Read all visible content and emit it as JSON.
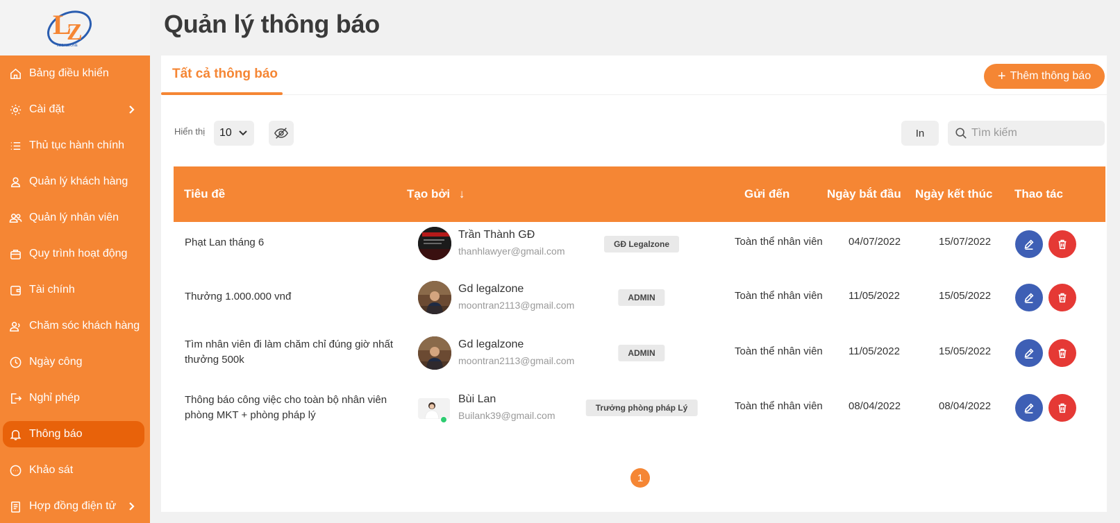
{
  "app": {
    "logo_name": "legalzone-logo"
  },
  "header": {
    "title": "Quản lý thông báo"
  },
  "sidebar": {
    "items": [
      {
        "label": "Bảng điều khiển",
        "icon": "home-icon",
        "has_submenu": false,
        "active": false
      },
      {
        "label": "Cài đặt",
        "icon": "gear-icon",
        "has_submenu": true,
        "active": false
      },
      {
        "label": "Thủ tục hành chính",
        "icon": "list-icon",
        "has_submenu": false,
        "active": false
      },
      {
        "label": "Quản lý khách hàng",
        "icon": "user-icon",
        "has_submenu": false,
        "active": false
      },
      {
        "label": "Quản lý nhân viên",
        "icon": "users-icon",
        "has_submenu": false,
        "active": false
      },
      {
        "label": "Quy trình hoạt động",
        "icon": "box-icon",
        "has_submenu": false,
        "active": false
      },
      {
        "label": "Tài chính",
        "icon": "wallet-icon",
        "has_submenu": false,
        "active": false
      },
      {
        "label": "Chăm sóc khách hàng",
        "icon": "user-care-icon",
        "has_submenu": false,
        "active": false
      },
      {
        "label": "Ngày công",
        "icon": "clock-icon",
        "has_submenu": false,
        "active": false
      },
      {
        "label": "Nghỉ phép",
        "icon": "logout-icon",
        "has_submenu": false,
        "active": false
      },
      {
        "label": "Thông báo",
        "icon": "bell-icon",
        "has_submenu": false,
        "active": true
      },
      {
        "label": "Khảo sát",
        "icon": "chat-icon",
        "has_submenu": false,
        "active": false
      },
      {
        "label": "Hợp đồng điện tử",
        "icon": "document-icon",
        "has_submenu": true,
        "active": false
      }
    ]
  },
  "main": {
    "tab_label": "Tất cả thông báo",
    "add_button_label": "Thêm thông báo",
    "show_label": "Hiển thị",
    "page_size": "10",
    "print_label": "In",
    "search_placeholder": "Tìm kiếm",
    "columns": {
      "title": "Tiêu đề",
      "created_by": "Tạo bởi",
      "sort_arrow": "↓",
      "send_to": "Gửi đến",
      "start_date": "Ngày bắt đầu",
      "end_date": "Ngày kết thúc",
      "actions": "Thao tác"
    },
    "rows": [
      {
        "title": "Phạt Lan tháng 6",
        "creator_name": "Trần Thành GĐ",
        "creator_email": "thanhlawyer@gmail.com",
        "role": "GĐ Legalzone",
        "send_to": "Toàn thể nhân viên",
        "start": "04/07/2022",
        "end": "15/07/2022"
      },
      {
        "title": "Thưởng 1.000.000 vnđ",
        "creator_name": "Gd legalzone",
        "creator_email": "moontran2113@gmail.com",
        "role": "ADMIN",
        "send_to": "Toàn thể nhân viên",
        "start": "11/05/2022",
        "end": "15/05/2022"
      },
      {
        "title": "Tìm nhân viên đi làm chăm chỉ đúng giờ nhất thưởng 500k",
        "creator_name": "Gd legalzone",
        "creator_email": "moontran2113@gmail.com",
        "role": "ADMIN",
        "send_to": "Toàn thể nhân viên",
        "start": "11/05/2022",
        "end": "15/05/2022"
      },
      {
        "title": "Thông báo công việc cho toàn bộ nhân viên phòng MKT + phòng pháp lý",
        "creator_name": "Bùi Lan",
        "creator_email": "Builank39@gmail.com",
        "role": "Trưởng phòng pháp Lý",
        "send_to": "Toàn thể nhân viên",
        "start": "08/04/2022",
        "end": "08/04/2022"
      }
    ],
    "current_page": "1"
  },
  "colors": {
    "accent": "#f58634",
    "accent_dark": "#e8620a",
    "edit": "#3e5fb5",
    "delete": "#e53935"
  }
}
